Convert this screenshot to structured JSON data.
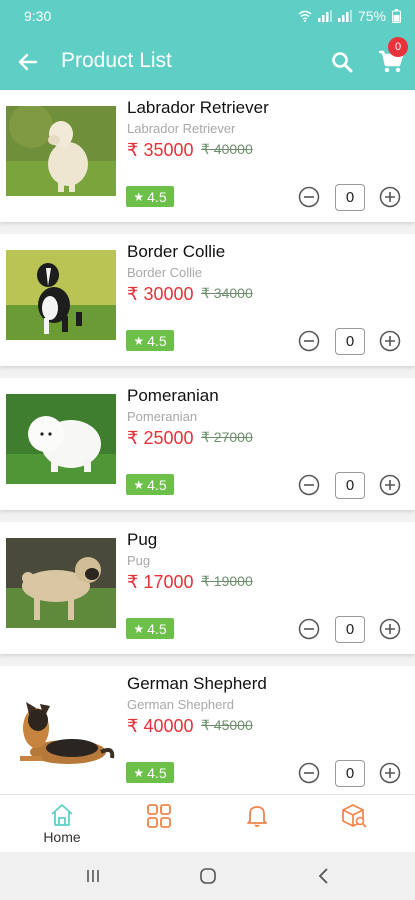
{
  "status_bar": {
    "time": "9:30",
    "battery": "75%"
  },
  "app_bar": {
    "title": "Product List",
    "cart_count": "0"
  },
  "products": [
    {
      "name": "Labrador Retriever",
      "breed": "Labrador Retriever",
      "price": "₹ 35000",
      "mrp": "₹ 40000",
      "rating": "4.5",
      "qty": "0"
    },
    {
      "name": "Border Collie",
      "breed": "Border Collie",
      "price": "₹ 30000",
      "mrp": "₹ 34000",
      "rating": "4.5",
      "qty": "0"
    },
    {
      "name": "Pomeranian",
      "breed": "Pomeranian",
      "price": "₹ 25000",
      "mrp": "₹ 27000",
      "rating": "4.5",
      "qty": "0"
    },
    {
      "name": "Pug",
      "breed": "Pug",
      "price": "₹ 17000",
      "mrp": "₹ 19000",
      "rating": "4.5",
      "qty": "0"
    },
    {
      "name": "German Shepherd",
      "breed": "German Shepherd",
      "price": "₹ 40000",
      "mrp": "₹ 45000",
      "rating": "4.5",
      "qty": "0"
    }
  ],
  "bottom_nav": {
    "home_label": "Home"
  },
  "icons": {
    "back": "arrow-left-icon",
    "search": "search-icon",
    "cart": "cart-icon",
    "star": "star-icon",
    "minus": "minus-circle-icon",
    "plus": "plus-circle-icon",
    "home": "home-icon",
    "categories": "grid-icon",
    "notifications": "bell-icon",
    "orders": "box-search-icon"
  },
  "colors": {
    "primary": "#5fcfc6",
    "price": "#e53238",
    "rating_bg": "#6cc04a",
    "badge": "#e8333c",
    "nav_accent": "#f0844a"
  }
}
